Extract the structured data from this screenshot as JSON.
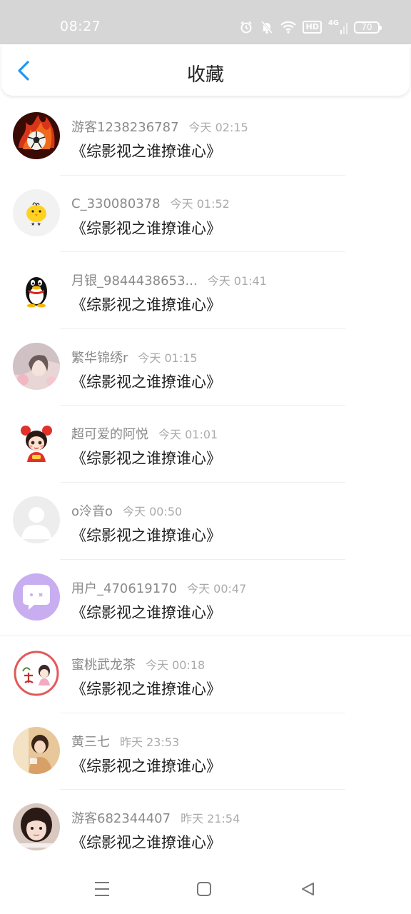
{
  "status_bar": {
    "time": "08:27",
    "hd": "HD",
    "network": "4G",
    "battery": "70"
  },
  "header": {
    "title": "收藏"
  },
  "items": [
    {
      "username": "游客1238236787",
      "time": "今天 02:15",
      "title": "《综影视之谁撩谁心》"
    },
    {
      "username": "C_330080378",
      "time": "今天 01:52",
      "title": "《综影视之谁撩谁心》"
    },
    {
      "username": "月银_9844438653...",
      "time": "今天 01:41",
      "title": "《综影视之谁撩谁心》"
    },
    {
      "username": "繁华锦绣r",
      "time": "今天 01:15",
      "title": "《综影视之谁撩谁心》"
    },
    {
      "username": "超可爱的阿悦",
      "time": "今天 01:01",
      "title": "《综影视之谁撩谁心》"
    },
    {
      "username": "o泠音o",
      "time": "今天 00:50",
      "title": "《综影视之谁撩谁心》"
    },
    {
      "username": "用户_470619170",
      "time": "今天 00:47",
      "title": "《综影视之谁撩谁心》"
    },
    {
      "username": "蜜桃武龙茶",
      "time": "今天 00:18",
      "title": "《综影视之谁撩谁心》"
    },
    {
      "username": "黄三七",
      "time": "昨天 23:53",
      "title": "《综影视之谁撩谁心》"
    },
    {
      "username": "游客682344407",
      "time": "昨天 21:54",
      "title": "《综影视之谁撩谁心》"
    }
  ],
  "avatar_icons": [
    "football-fire-icon",
    "yellow-chick-icon",
    "penguin-icon",
    "girl-photo-icon",
    "cartoon-girl-icon",
    "default-user-icon",
    "chat-bubble-icon",
    "wu-seal-icon",
    "photo-icon",
    "girl-face-icon"
  ],
  "colors": {
    "accent": "#2196f3",
    "status_bar": "#d6d6d6",
    "title_text": "#1f1f1f",
    "meta_text": "#8a8a8a"
  }
}
